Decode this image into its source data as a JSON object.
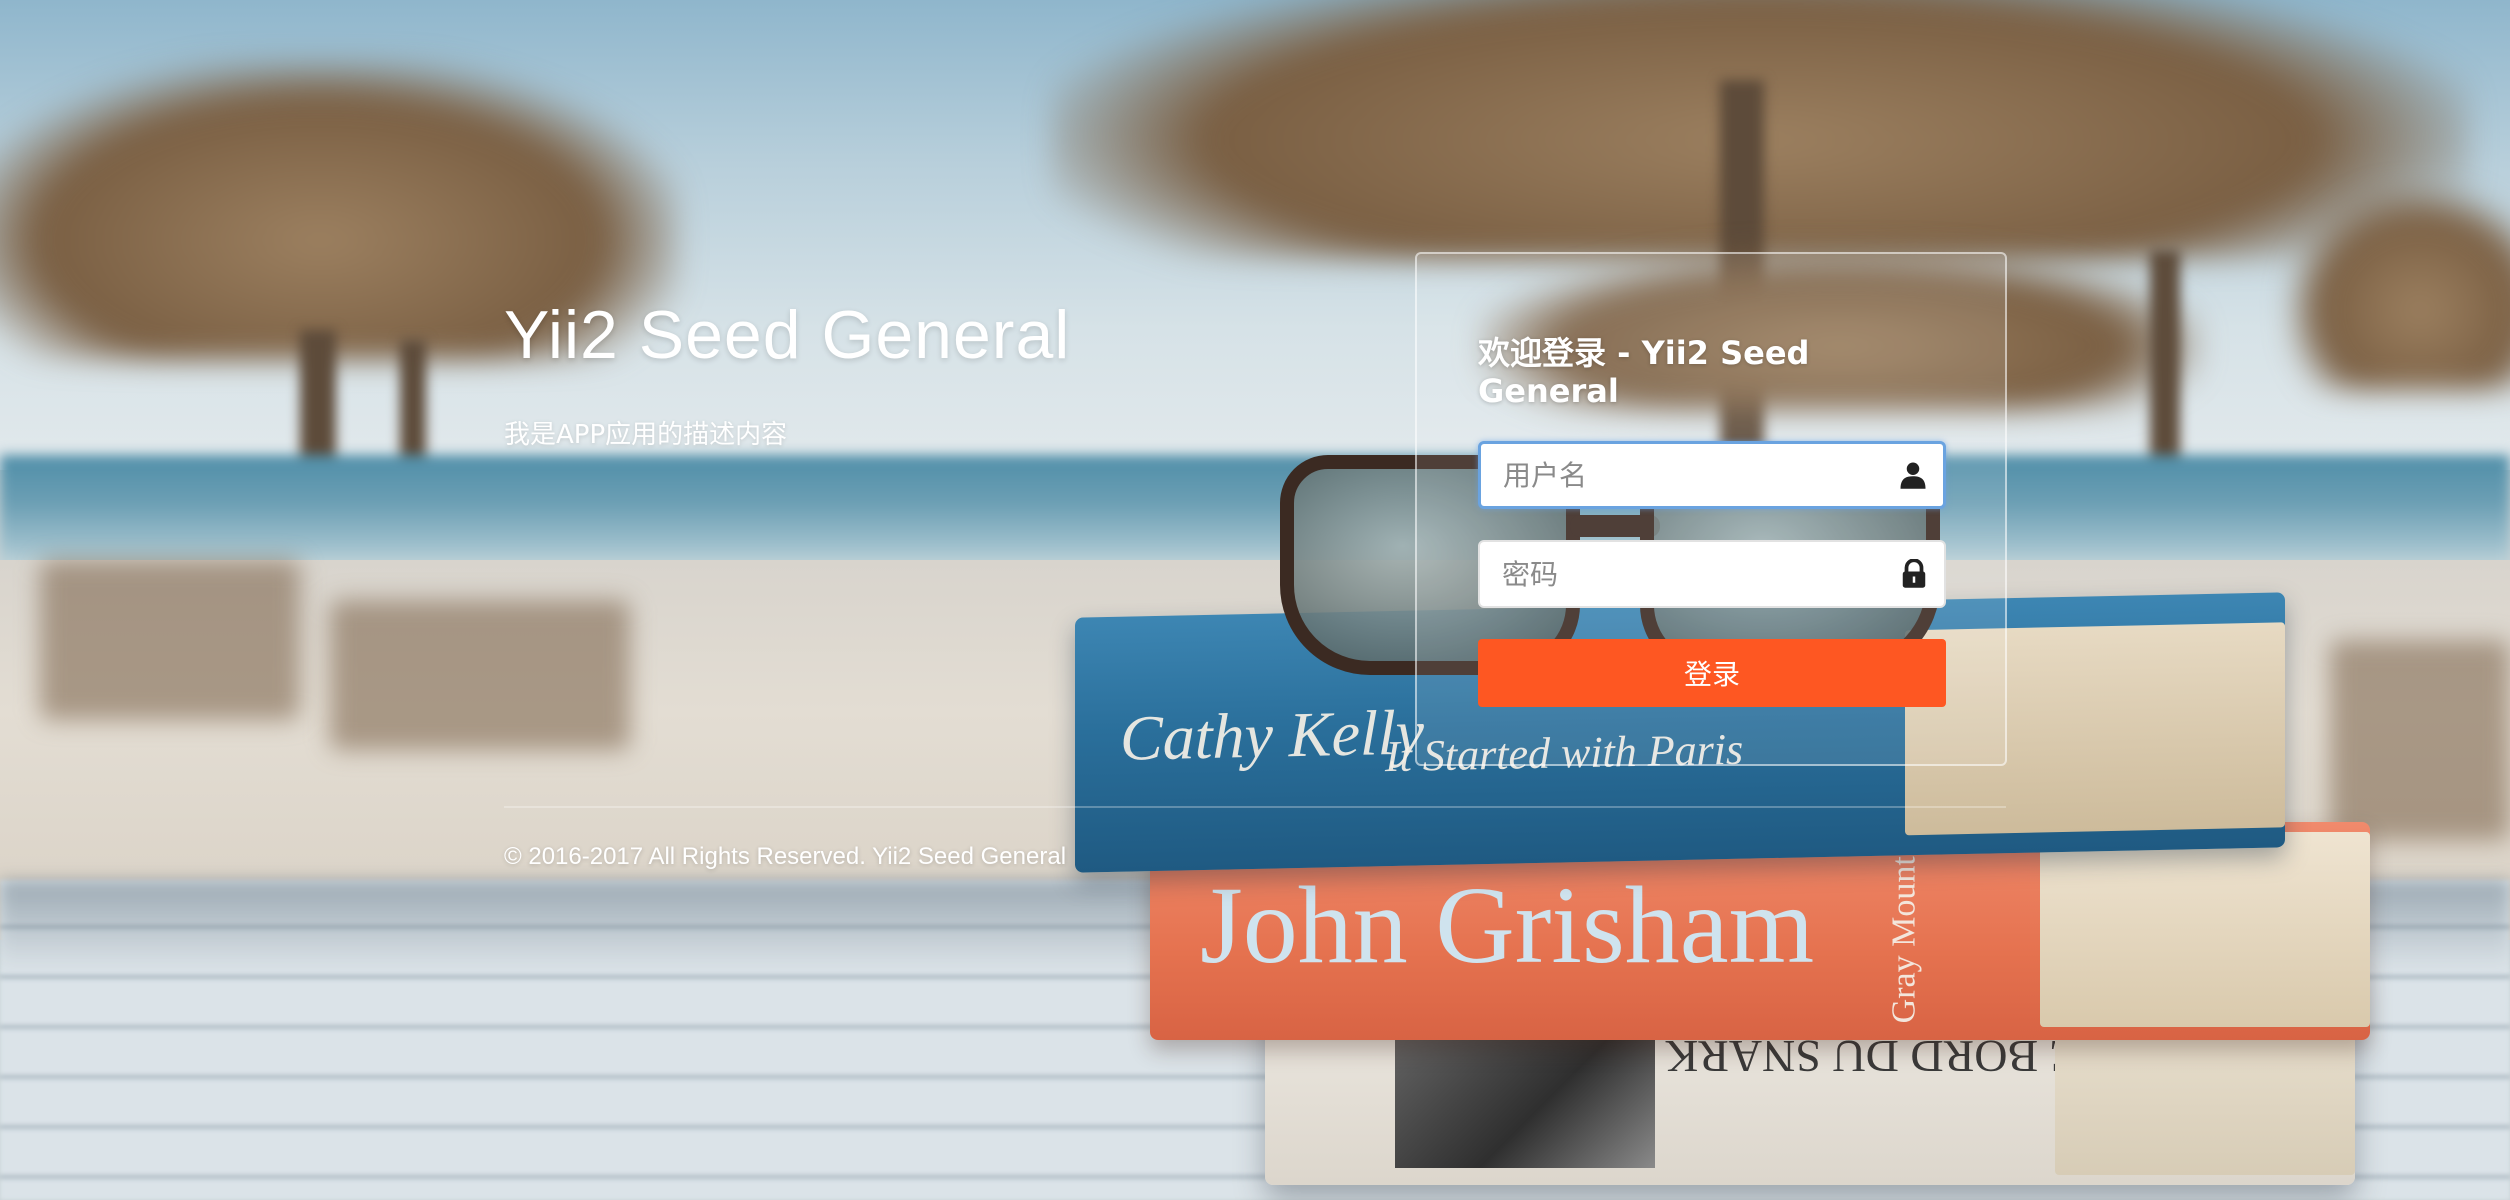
{
  "app": {
    "title": "Yii2 Seed General",
    "description": "我是APP应用的描述内容",
    "footer": "© 2016-2017 All Rights Reserved. Yii2 Seed General"
  },
  "login": {
    "title": "欢迎登录 - Yii2 Seed General",
    "username": {
      "placeholder": "用户名",
      "value": "",
      "icon": "user-icon"
    },
    "password": {
      "placeholder": "密码",
      "value": "",
      "icon": "lock-icon"
    },
    "submit_label": "登录"
  },
  "background": {
    "books": [
      "Cathy Kelly",
      "It Started with Paris",
      "John Grisham",
      "Gray Mountain",
      "JOURNAL DE BORD DU SNARK"
    ]
  },
  "colors": {
    "accent": "#fe5722",
    "focus_border": "#6aa3e0"
  }
}
